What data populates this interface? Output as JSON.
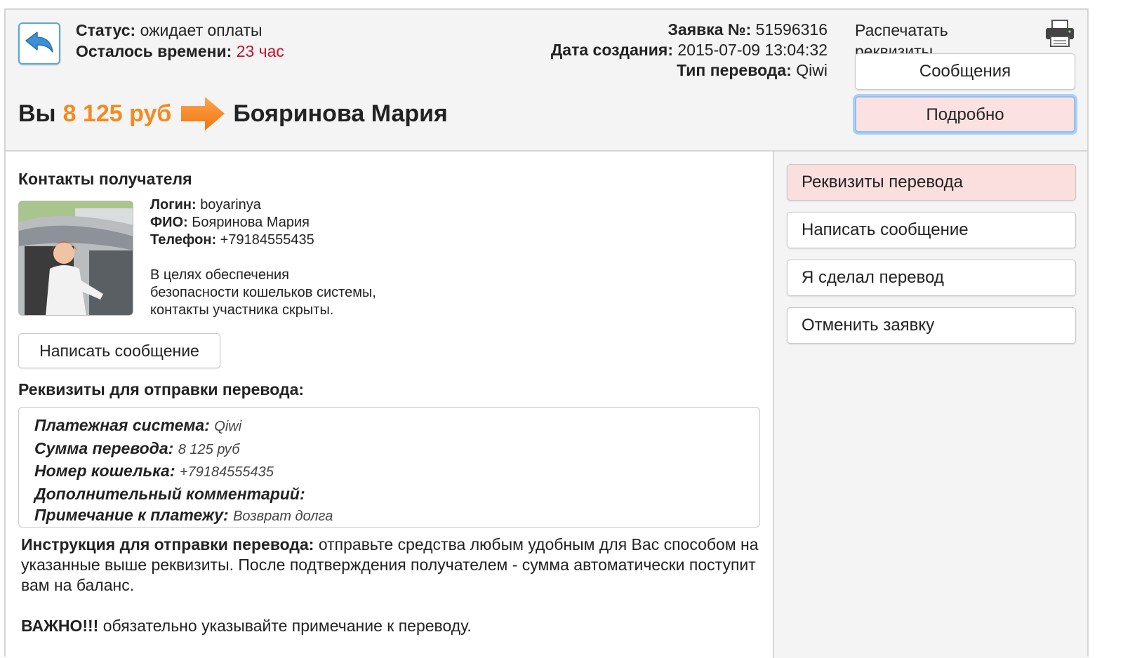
{
  "header": {
    "status_label": "Статус:",
    "status_value": "ожидает оплаты",
    "time_label": "Осталось времени:",
    "time_value": "23 час",
    "order_label": "Заявка №:",
    "order_value": "51596316",
    "date_label": "Дата создания:",
    "date_value": "2015-07-09 13:04:32",
    "type_label": "Тип перевода:",
    "type_value": "Qiwi",
    "print_label": "Распечатать реквизиты",
    "messages_button": "Сообщения",
    "details_button": "Подробно",
    "you_label": "Вы",
    "amount": "8 125 руб",
    "recipient_name": "Бояринова Мария"
  },
  "contacts": {
    "title": "Контакты получателя",
    "login_label": "Логин:",
    "login_value": "boyarinya",
    "fio_label": "ФИО:",
    "fio_value": "Бояринова Мария",
    "phone_label": "Телефон:",
    "phone_value": "+79184555435",
    "notice_lines": [
      "В целях обеспечения",
      "безопасности кошельков системы,",
      "контакты участника скрыты."
    ],
    "write_button": "Написать сообщение"
  },
  "requisites": {
    "title": "Реквизиты для отправки перевода:",
    "payment_system_label": "Платежная система:",
    "payment_system_value": "Qiwi",
    "sum_label": "Сумма перевода:",
    "sum_value": "8 125 руб",
    "wallet_label": "Номер кошелька:",
    "wallet_value": "+79184555435",
    "comment_label": "Дополнительный комментарий:",
    "note_label": "Примечание к платежу:",
    "note_value": "Возврат долга"
  },
  "instructions": {
    "label": "Инструкция для отправки перевода:",
    "text": "отправьте средства любым удобным для Вас способом на указанные выше реквизиты. После подтверждения получателем - сумма автоматически поступит вам на баланс.",
    "important_label": "ВАЖНО!!!",
    "important_text": "обязательно указывайте примечание к переводу."
  },
  "sidebar": {
    "items": [
      {
        "label": "Реквизиты перевода"
      },
      {
        "label": "Написать сообщение"
      },
      {
        "label": "Я сделал перевод"
      },
      {
        "label": "Отменить заявку"
      }
    ]
  },
  "colors": {
    "accent_orange": "#f28a1e",
    "time_red": "#c8102e",
    "active_pink": "#fbe1e1",
    "focus_blue": "#8ebff0"
  },
  "icons": {
    "back": "back-arrow-icon",
    "print": "printer-icon",
    "transfer": "arrow-right-icon"
  }
}
